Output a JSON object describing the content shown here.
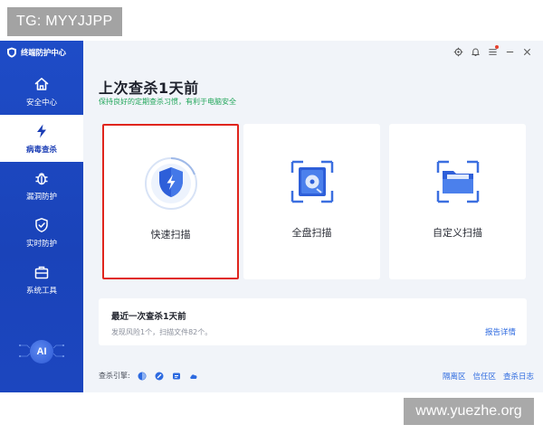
{
  "overlay": {
    "tg_label": "TG: MYYJJPP",
    "watermark": "www.yuezhe.org"
  },
  "app": {
    "title": "终端防护中心"
  },
  "sidebar": {
    "items": [
      {
        "label": "安全中心",
        "icon": "home-icon"
      },
      {
        "label": "病毒查杀",
        "icon": "lightning-icon"
      },
      {
        "label": "漏洞防护",
        "icon": "bug-icon"
      },
      {
        "label": "实时防护",
        "icon": "shield-check-icon"
      },
      {
        "label": "系统工具",
        "icon": "toolbox-icon"
      }
    ],
    "active_index": 1,
    "ai_label": "AI"
  },
  "window_controls": [
    "settings-icon",
    "bell-icon",
    "menu-icon",
    "minimize-icon",
    "close-icon"
  ],
  "main": {
    "title": "上次查杀1天前",
    "subtitle": "保持良好的定期查杀习惯，有利于电脑安全"
  },
  "scan_cards": [
    {
      "label": "快速扫描",
      "icon": "quick-scan-shield-icon",
      "highlighted": true
    },
    {
      "label": "全盘扫描",
      "icon": "disk-scan-icon",
      "highlighted": false
    },
    {
      "label": "自定义扫描",
      "icon": "folder-scan-icon",
      "highlighted": false
    }
  ],
  "info": {
    "title": "最近一次查杀1天前",
    "summary": "发现风险1个，扫描文件82个。",
    "details_link": "报告详情"
  },
  "footer": {
    "engine_label": "查杀引擎:",
    "engines": [
      "engine-1-icon",
      "engine-2-icon",
      "engine-3-icon",
      "engine-4-icon"
    ],
    "links": [
      "隔离区",
      "信任区",
      "查杀日志"
    ]
  },
  "colors": {
    "sidebar": "#1e4cc7",
    "accent": "#2d6ae0",
    "highlight_border": "#e0251d",
    "subtitle_green": "#21a65a"
  }
}
